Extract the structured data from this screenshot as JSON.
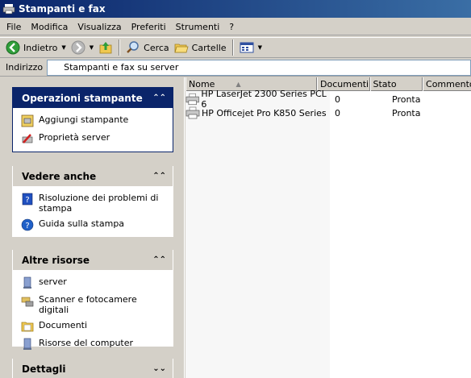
{
  "window": {
    "title": "Stampanti e fax"
  },
  "menu": [
    {
      "label": "File"
    },
    {
      "label": "Modifica"
    },
    {
      "label": "Visualizza"
    },
    {
      "label": "Preferiti"
    },
    {
      "label": "Strumenti"
    },
    {
      "label": "?"
    }
  ],
  "toolbar": {
    "back": "Indietro",
    "search": "Cerca",
    "folders": "Cartelle"
  },
  "address": {
    "label": "Indirizzo",
    "value": "Stampanti e fax su server"
  },
  "panels": {
    "printer_ops": {
      "title": "Operazioni stampante",
      "items": [
        {
          "label": "Aggiungi stampante",
          "icon": "add-printer-icon"
        },
        {
          "label": "Proprietà server",
          "icon": "server-properties-icon"
        }
      ]
    },
    "see_also": {
      "title": "Vedere anche",
      "items": [
        {
          "label": "Risoluzione dei problemi di",
          "label2": "stampa",
          "icon": "help-book-icon"
        },
        {
          "label": "Guida sulla stampa",
          "icon": "help-icon"
        }
      ]
    },
    "other_places": {
      "title": "Altre risorse",
      "items": [
        {
          "label": "server",
          "icon": "computer-icon"
        },
        {
          "label": "Scanner e fotocamere digitali",
          "icon": "scanner-icon"
        },
        {
          "label": "Documenti",
          "icon": "folder-icon"
        },
        {
          "label": "Risorse del computer",
          "icon": "my-computer-icon"
        }
      ]
    },
    "details": {
      "title": "Dettagli"
    }
  },
  "list": {
    "columns": [
      "Nome",
      "Documenti",
      "Stato",
      "Commento"
    ],
    "rows": [
      {
        "name": "HP LaserJet 2300 Series PCL 6",
        "docs": "0",
        "state": "Pronta"
      },
      {
        "name": "HP Officejet Pro K850 Series",
        "docs": "0",
        "state": "Pronta"
      }
    ]
  }
}
